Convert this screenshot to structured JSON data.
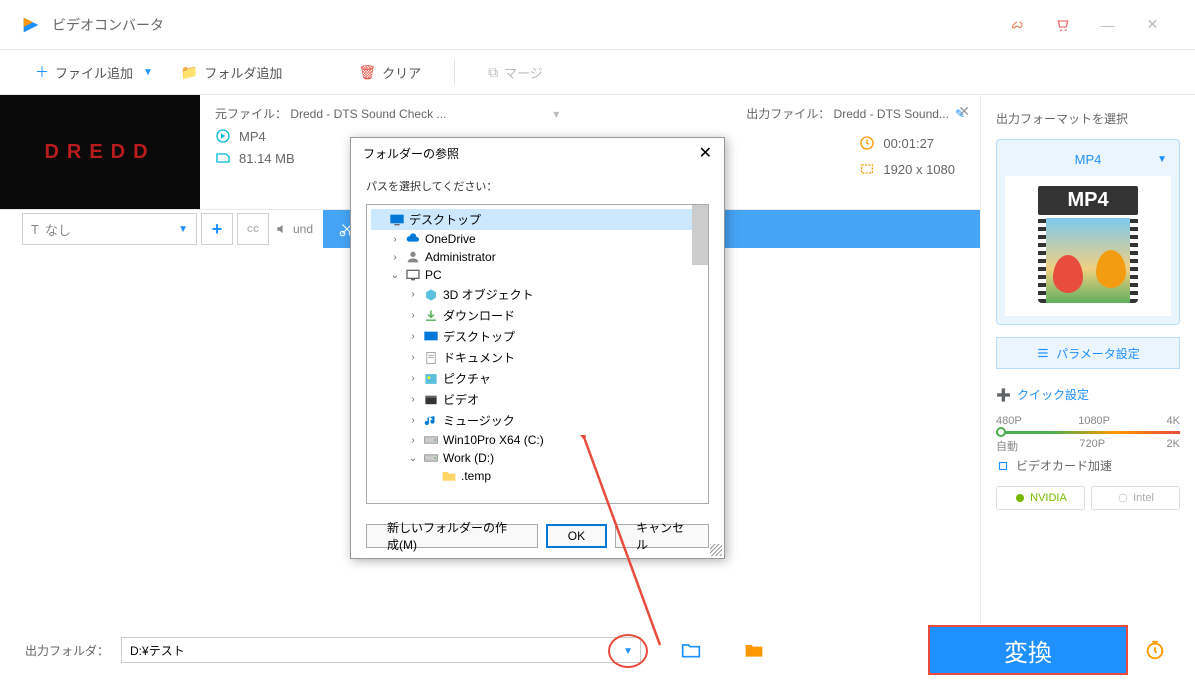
{
  "app": {
    "title": "ビデオコンバータ"
  },
  "toolbar": {
    "add_file": "ファイル追加",
    "add_folder": "フォルダ追加",
    "clear": "クリア",
    "merge": "マージ"
  },
  "file": {
    "thumb_text": "DREDD",
    "src_label": "元ファイル： Dredd - DTS Sound Check ...",
    "out_label": "出力ファイル： Dredd - DTS Sound...",
    "format": "MP4",
    "size": "81.14 MB",
    "duration": "00:01:27",
    "resolution": "1920 x 1080",
    "subtitle": "なし",
    "audio_label": "und"
  },
  "sidebar": {
    "title": "出力フォーマットを選択",
    "format": "MP4",
    "preview_label": "MP4",
    "param": "パラメータ設定",
    "quick_title": "クイック設定",
    "res_top": {
      "a": "480P",
      "b": "1080P",
      "c": "4K"
    },
    "res_bot": {
      "a": "自動",
      "b": "720P",
      "c": "2K"
    },
    "accel": "ビデオカード加速",
    "nvidia": "NVIDIA",
    "intel": "Intel"
  },
  "bottom": {
    "label": "出力フォルダ：",
    "path": "D:¥テスト",
    "convert": "変換"
  },
  "dialog": {
    "title": "フォルダーの参照",
    "prompt": "パスを選択してください：",
    "new_folder": "新しいフォルダーの作成(M)",
    "ok": "OK",
    "cancel": "キャンセル",
    "tree": [
      {
        "depth": 0,
        "label": "デスクトップ",
        "icon": "desktop",
        "sel": true
      },
      {
        "depth": 1,
        "label": "OneDrive",
        "icon": "cloud",
        "exp": ">"
      },
      {
        "depth": 1,
        "label": "Administrator",
        "icon": "user",
        "exp": ">"
      },
      {
        "depth": 1,
        "label": "PC",
        "icon": "pc",
        "exp": "v"
      },
      {
        "depth": 2,
        "label": "3D オブジェクト",
        "icon": "3d",
        "exp": ">"
      },
      {
        "depth": 2,
        "label": "ダウンロード",
        "icon": "download",
        "exp": ">"
      },
      {
        "depth": 2,
        "label": "デスクトップ",
        "icon": "desktop2",
        "exp": ">"
      },
      {
        "depth": 2,
        "label": "ドキュメント",
        "icon": "doc",
        "exp": ">"
      },
      {
        "depth": 2,
        "label": "ピクチャ",
        "icon": "pic",
        "exp": ">"
      },
      {
        "depth": 2,
        "label": "ビデオ",
        "icon": "video",
        "exp": ">"
      },
      {
        "depth": 2,
        "label": "ミュージック",
        "icon": "music",
        "exp": ">"
      },
      {
        "depth": 2,
        "label": "Win10Pro X64 (C:)",
        "icon": "drive",
        "exp": ">"
      },
      {
        "depth": 2,
        "label": "Work (D:)",
        "icon": "drive",
        "exp": "v"
      },
      {
        "depth": 3,
        "label": ".temp",
        "icon": "folder",
        "exp": ""
      }
    ]
  }
}
